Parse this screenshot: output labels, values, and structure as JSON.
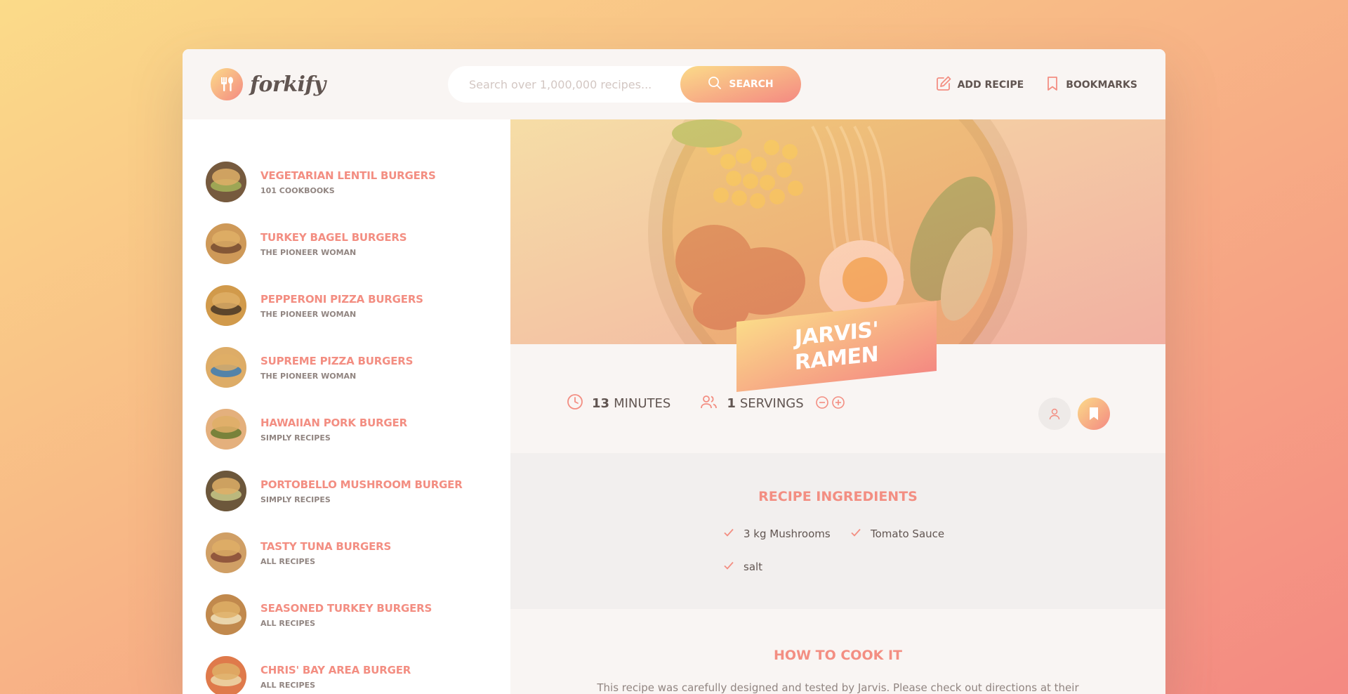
{
  "app": {
    "name": "forkify"
  },
  "search": {
    "placeholder": "Search over 1,000,000 recipes...",
    "button_label": "Search"
  },
  "nav": {
    "add_recipe_label": "Add recipe",
    "bookmarks_label": "Bookmarks"
  },
  "results": [
    {
      "title": "Vegetarian Lentil Burgers",
      "publisher": "101 Cookbooks",
      "colors": [
        "#5a3e2e",
        "#8a9a4a"
      ]
    },
    {
      "title": "Turkey Bagel Burgers",
      "publisher": "The Pioneer Woman",
      "colors": [
        "#c58a4e",
        "#6b3a24"
      ]
    },
    {
      "title": "Pepperoni Pizza Burgers",
      "publisher": "The Pioneer Woman",
      "colors": [
        "#c98b3e",
        "#3a2416"
      ]
    },
    {
      "title": "Supreme Pizza Burgers",
      "publisher": "The Pioneer Woman",
      "colors": [
        "#d7a160",
        "#2f6fb0"
      ]
    },
    {
      "title": "Hawaiian Pork Burger",
      "publisher": "Simply Recipes",
      "colors": [
        "#e0a77a",
        "#5d6e2a"
      ]
    },
    {
      "title": "Portobello Mushroom Burger",
      "publisher": "Simply Recipes",
      "colors": [
        "#4e3a2a",
        "#aeb07a"
      ]
    },
    {
      "title": "Tasty Tuna Burgers",
      "publisher": "All Recipes",
      "colors": [
        "#c7925d",
        "#7c3a2c"
      ]
    },
    {
      "title": "Seasoned Turkey Burgers",
      "publisher": "All Recipes",
      "colors": [
        "#b57740",
        "#e7d3b2"
      ]
    },
    {
      "title": "Chris' Bay Area Burger",
      "publisher": "All Recipes",
      "colors": [
        "#d9653e",
        "#e8c9a0"
      ]
    }
  ],
  "recipe": {
    "title": "Jarvis' Ramen",
    "cooking_time": "13",
    "cooking_time_unit": "minutes",
    "servings": "1",
    "servings_unit": "servings",
    "ingredients_heading": "Recipe ingredients",
    "ingredients": [
      "3 kg Mushrooms",
      "Tomato Sauce",
      "salt"
    ],
    "howto_heading": "How to cook it",
    "howto_text": "This recipe was carefully designed and tested by Jarvis. Please check out directions at their"
  },
  "colors": {
    "accent": "#f38e82",
    "gradient_start": "#fbdb89",
    "gradient_end": "#f48982",
    "text": "#615551"
  }
}
